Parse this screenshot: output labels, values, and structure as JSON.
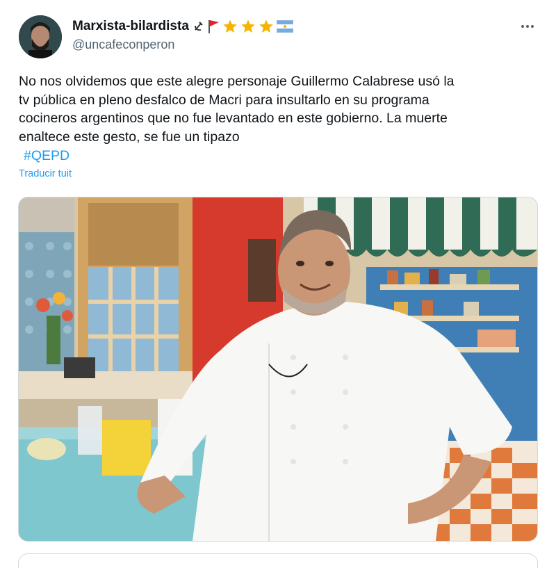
{
  "user": {
    "display_name": "Marxista-bilardista",
    "handle": "@uncafeconperon",
    "badges": [
      "hammer-sickle-icon",
      "red-flag-icon",
      "star-icon",
      "star-icon",
      "star-icon",
      "argentina-flag-icon"
    ]
  },
  "tweet": {
    "text": "No nos olvidemos que este alegre personaje Guillermo Calabrese usó la\ntv pública en pleno desfalco de Macri para insultarlo en su programa\ncocineros argentinos que no fue levantado en este gobierno. La muerte\nenaltece este gesto, se fue un tipazo",
    "hashtag": "#QEPD",
    "translate_label": "Traducir tuit"
  },
  "colors": {
    "link": "#1d9bf0",
    "secondary_text": "#536471",
    "star": "#f4b400",
    "flag_red": "#e0232a"
  },
  "icons": {
    "more": "more-options-icon"
  }
}
